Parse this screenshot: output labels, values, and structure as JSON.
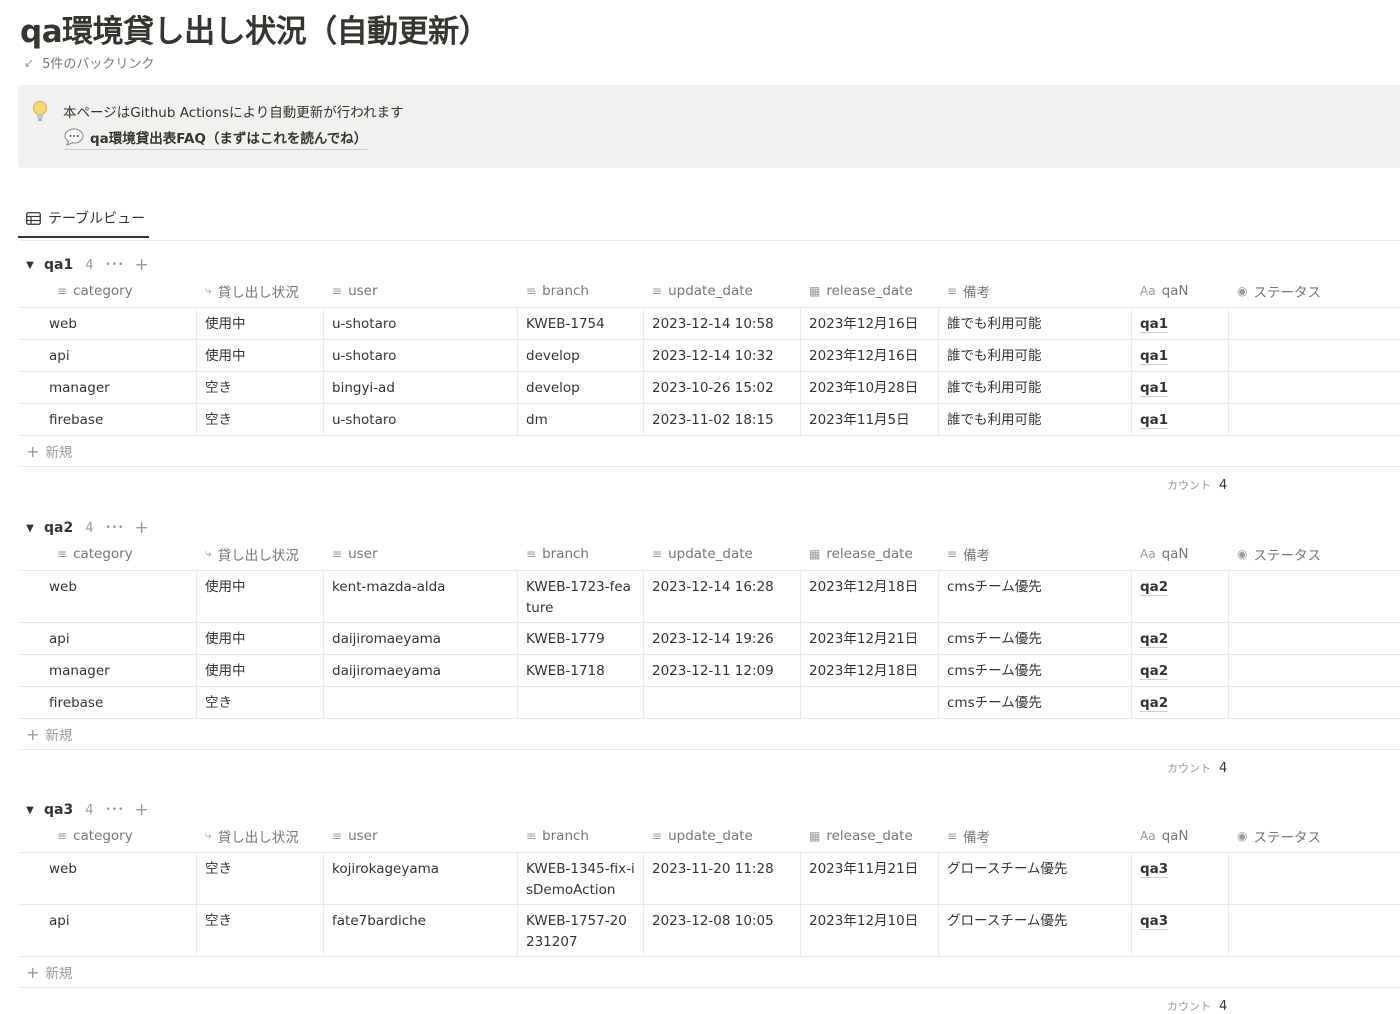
{
  "page": {
    "title": "qa環境貸し出し状況（自動更新）",
    "backlinks": "5件のバックリンク"
  },
  "callout": {
    "text": "本ページはGithub Actionsにより自動更新が行われます",
    "link": "qa環境貸出表FAQ（まずはこれを読んでね）"
  },
  "view": {
    "tab_label": "テーブルビュー"
  },
  "columns": [
    "category",
    "貸し出し状況",
    "user",
    "branch",
    "update_date",
    "release_date",
    "備考",
    "qaN",
    "ステータス"
  ],
  "column_icons": [
    "text-lines-icon",
    "relation-rollup-icon",
    "text-lines-icon",
    "text-lines-icon",
    "text-lines-icon",
    "calendar-icon",
    "text-lines-icon",
    "title-aa-icon",
    "status-icon"
  ],
  "new_label": "新規",
  "count_label": "カウント",
  "groups": [
    {
      "name": "qa1",
      "count": "4",
      "total": "4",
      "rows": [
        [
          "web",
          "使用中",
          "u-shotaro",
          "KWEB-1754",
          "2023-12-14 10:58",
          "2023年12月16日",
          "誰でも利用可能",
          "qa1",
          ""
        ],
        [
          "api",
          "使用中",
          "u-shotaro",
          "develop",
          "2023-12-14 10:32",
          "2023年12月16日",
          "誰でも利用可能",
          "qa1",
          ""
        ],
        [
          "manager",
          "空き",
          "bingyi-ad",
          "develop",
          "2023-10-26 15:02",
          "2023年10月28日",
          "誰でも利用可能",
          "qa1",
          ""
        ],
        [
          "firebase",
          "空き",
          "u-shotaro",
          "dm",
          "2023-11-02 18:15",
          "2023年11月5日",
          "誰でも利用可能",
          "qa1",
          ""
        ]
      ]
    },
    {
      "name": "qa2",
      "count": "4",
      "total": "4",
      "rows": [
        [
          "web",
          "使用中",
          "kent-mazda-alda",
          "KWEB-1723-feature",
          "2023-12-14 16:28",
          "2023年12月18日",
          "cmsチーム優先",
          "qa2",
          ""
        ],
        [
          "api",
          "使用中",
          "daijiromaeyama",
          "KWEB-1779",
          "2023-12-14 19:26",
          "2023年12月21日",
          "cmsチーム優先",
          "qa2",
          ""
        ],
        [
          "manager",
          "使用中",
          "daijiromaeyama",
          "KWEB-1718",
          "2023-12-11 12:09",
          "2023年12月18日",
          "cmsチーム優先",
          "qa2",
          ""
        ],
        [
          "firebase",
          "空き",
          "",
          "",
          "",
          "",
          "cmsチーム優先",
          "qa2",
          ""
        ]
      ]
    },
    {
      "name": "qa3",
      "count": "4",
      "total": "4",
      "rows": [
        [
          "web",
          "空き",
          "kojirokageyama",
          "KWEB-1345-fix-isDemoAction",
          "2023-11-20 11:28",
          "2023年11月21日",
          "グロースチーム優先",
          "qa3",
          ""
        ],
        [
          "api",
          "空き",
          "fate7bardiche",
          "KWEB-1757-20231207",
          "2023-12-08 10:05",
          "2023年12月10日",
          "グロースチーム優先",
          "qa3",
          ""
        ]
      ]
    }
  ]
}
